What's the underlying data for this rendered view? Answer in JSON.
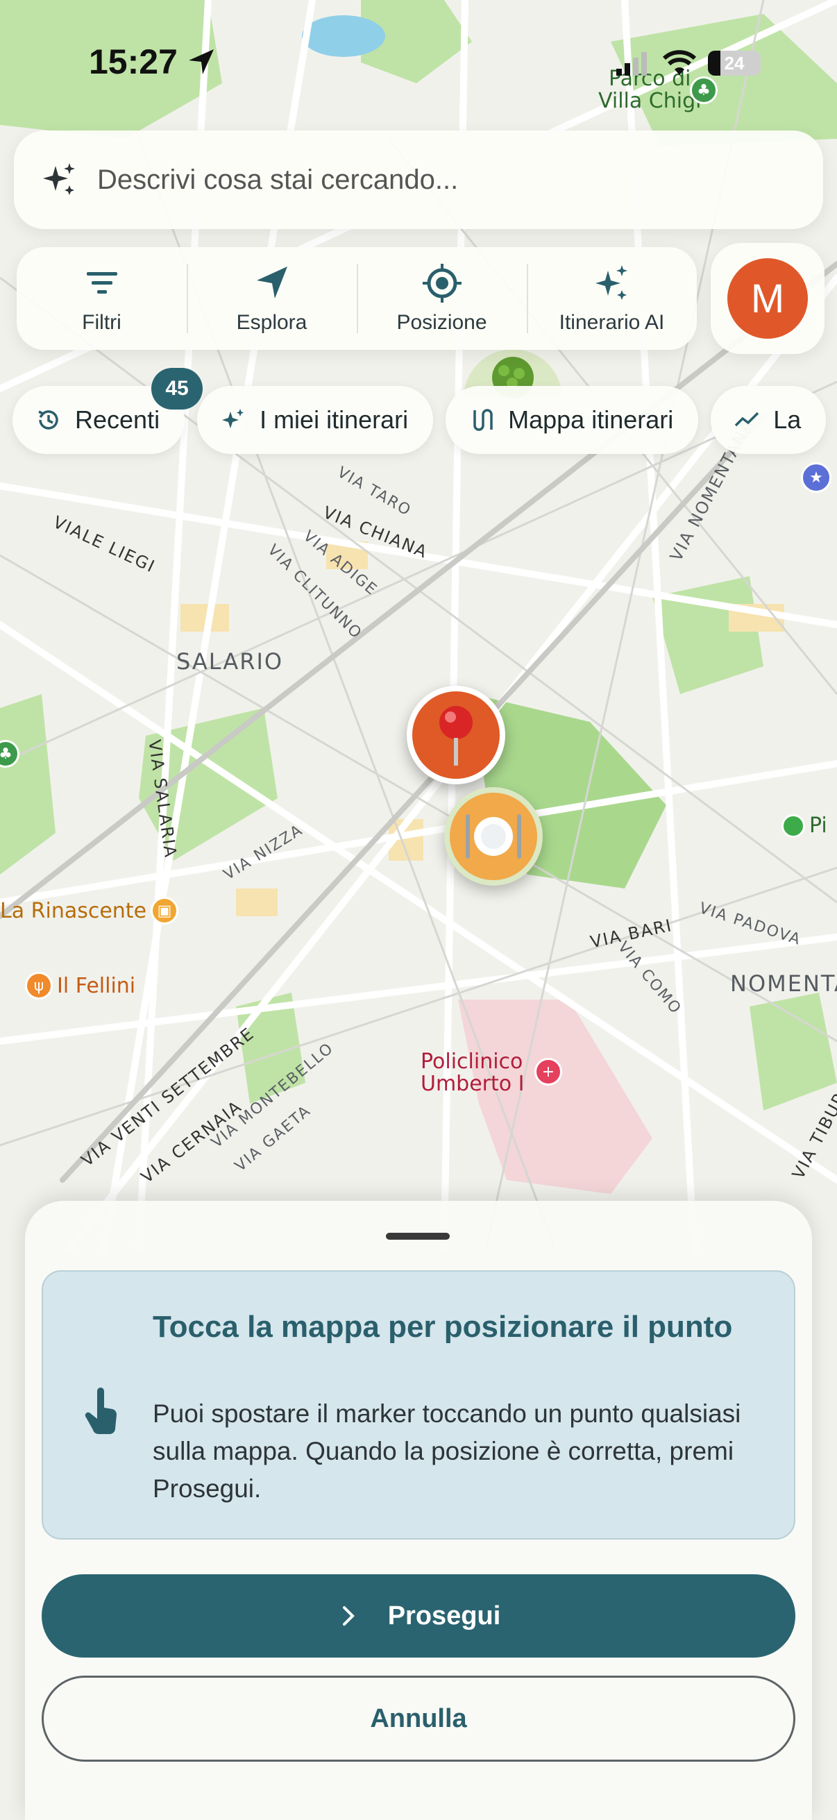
{
  "status_bar": {
    "time": "15:27",
    "battery": "24"
  },
  "search": {
    "placeholder": "Descrivi cosa stai cercando..."
  },
  "toolbar": {
    "items": [
      {
        "label": "Filtri",
        "icon": "filter-icon"
      },
      {
        "label": "Esplora",
        "icon": "navigation-arrow-icon"
      },
      {
        "label": "Posizione",
        "icon": "crosshair-location-icon"
      },
      {
        "label": "Itinerario AI",
        "icon": "sparkles-icon"
      }
    ],
    "avatar_initial": "M"
  },
  "chips": [
    {
      "label": "Recenti",
      "icon": "history-icon",
      "badge": "45"
    },
    {
      "label": "I miei itinerari",
      "icon": "sparkles-icon"
    },
    {
      "label": "Mappa itinerari",
      "icon": "route-icon"
    },
    {
      "label": "La",
      "icon": "trend-icon"
    }
  ],
  "map": {
    "labels": {
      "salario": "SALARIO",
      "nomentana_district": "NOMENTA",
      "via_nomentana": "VIA NOMENTANA",
      "via_chiana": "VIA CHIANA",
      "via_taro": "VIA TARO",
      "via_adige": "VIA ADIGE",
      "via_clitunno": "VIA CLITUNNO",
      "viale_liegi": "VIALE LIEGI",
      "via_salaria": "VIA SALARIA",
      "via_nizza": "VIA NIZZA",
      "via_bari": "VIA BARI",
      "via_padova": "VIA PADOVA",
      "via_como": "VIA COMO",
      "via_venti_settembre": "VIA VENTI SETTEMBRE",
      "via_cernaia": "VIA CERNAIA",
      "via_montebello": "VIA MONTEBELLO",
      "via_gaeta": "VIA GAETA",
      "via_tibur": "VIA TIBUR",
      "parco_line1": "Parco di",
      "parco_line2": "Villa Chigi",
      "rinascente": "La Rinascente",
      "fellini": "Il Fellini",
      "policlinico_line1": "Policlinico",
      "policlinico_line2": "Umberto I",
      "pi": "Pi"
    }
  },
  "sheet": {
    "title": "Tocca la mappa per posizionare il punto",
    "body": "Puoi spostare il marker toccando un punto qualsiasi sulla mappa. Quando la posizione è corretta, premi Prosegui.",
    "primary_label": "Prosegui",
    "secondary_label": "Annulla"
  },
  "colors": {
    "accent": "#2a6470",
    "marker_pin": "#df5a26",
    "marker_food": "#f1a949",
    "avatar": "#e0582a",
    "info_bg": "#d5e6ec"
  }
}
